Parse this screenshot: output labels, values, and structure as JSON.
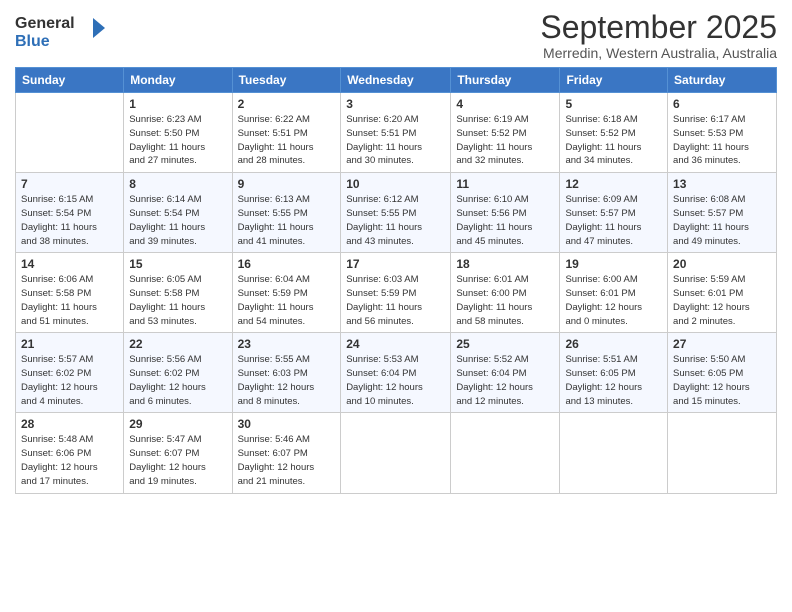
{
  "logo": {
    "line1": "General",
    "line2": "Blue"
  },
  "title": "September 2025",
  "subtitle": "Merredin, Western Australia, Australia",
  "headers": [
    "Sunday",
    "Monday",
    "Tuesday",
    "Wednesday",
    "Thursday",
    "Friday",
    "Saturday"
  ],
  "weeks": [
    [
      {
        "day": "",
        "info": ""
      },
      {
        "day": "1",
        "info": "Sunrise: 6:23 AM\nSunset: 5:50 PM\nDaylight: 11 hours\nand 27 minutes."
      },
      {
        "day": "2",
        "info": "Sunrise: 6:22 AM\nSunset: 5:51 PM\nDaylight: 11 hours\nand 28 minutes."
      },
      {
        "day": "3",
        "info": "Sunrise: 6:20 AM\nSunset: 5:51 PM\nDaylight: 11 hours\nand 30 minutes."
      },
      {
        "day": "4",
        "info": "Sunrise: 6:19 AM\nSunset: 5:52 PM\nDaylight: 11 hours\nand 32 minutes."
      },
      {
        "day": "5",
        "info": "Sunrise: 6:18 AM\nSunset: 5:52 PM\nDaylight: 11 hours\nand 34 minutes."
      },
      {
        "day": "6",
        "info": "Sunrise: 6:17 AM\nSunset: 5:53 PM\nDaylight: 11 hours\nand 36 minutes."
      }
    ],
    [
      {
        "day": "7",
        "info": "Sunrise: 6:15 AM\nSunset: 5:54 PM\nDaylight: 11 hours\nand 38 minutes."
      },
      {
        "day": "8",
        "info": "Sunrise: 6:14 AM\nSunset: 5:54 PM\nDaylight: 11 hours\nand 39 minutes."
      },
      {
        "day": "9",
        "info": "Sunrise: 6:13 AM\nSunset: 5:55 PM\nDaylight: 11 hours\nand 41 minutes."
      },
      {
        "day": "10",
        "info": "Sunrise: 6:12 AM\nSunset: 5:55 PM\nDaylight: 11 hours\nand 43 minutes."
      },
      {
        "day": "11",
        "info": "Sunrise: 6:10 AM\nSunset: 5:56 PM\nDaylight: 11 hours\nand 45 minutes."
      },
      {
        "day": "12",
        "info": "Sunrise: 6:09 AM\nSunset: 5:57 PM\nDaylight: 11 hours\nand 47 minutes."
      },
      {
        "day": "13",
        "info": "Sunrise: 6:08 AM\nSunset: 5:57 PM\nDaylight: 11 hours\nand 49 minutes."
      }
    ],
    [
      {
        "day": "14",
        "info": "Sunrise: 6:06 AM\nSunset: 5:58 PM\nDaylight: 11 hours\nand 51 minutes."
      },
      {
        "day": "15",
        "info": "Sunrise: 6:05 AM\nSunset: 5:58 PM\nDaylight: 11 hours\nand 53 minutes."
      },
      {
        "day": "16",
        "info": "Sunrise: 6:04 AM\nSunset: 5:59 PM\nDaylight: 11 hours\nand 54 minutes."
      },
      {
        "day": "17",
        "info": "Sunrise: 6:03 AM\nSunset: 5:59 PM\nDaylight: 11 hours\nand 56 minutes."
      },
      {
        "day": "18",
        "info": "Sunrise: 6:01 AM\nSunset: 6:00 PM\nDaylight: 11 hours\nand 58 minutes."
      },
      {
        "day": "19",
        "info": "Sunrise: 6:00 AM\nSunset: 6:01 PM\nDaylight: 12 hours\nand 0 minutes."
      },
      {
        "day": "20",
        "info": "Sunrise: 5:59 AM\nSunset: 6:01 PM\nDaylight: 12 hours\nand 2 minutes."
      }
    ],
    [
      {
        "day": "21",
        "info": "Sunrise: 5:57 AM\nSunset: 6:02 PM\nDaylight: 12 hours\nand 4 minutes."
      },
      {
        "day": "22",
        "info": "Sunrise: 5:56 AM\nSunset: 6:02 PM\nDaylight: 12 hours\nand 6 minutes."
      },
      {
        "day": "23",
        "info": "Sunrise: 5:55 AM\nSunset: 6:03 PM\nDaylight: 12 hours\nand 8 minutes."
      },
      {
        "day": "24",
        "info": "Sunrise: 5:53 AM\nSunset: 6:04 PM\nDaylight: 12 hours\nand 10 minutes."
      },
      {
        "day": "25",
        "info": "Sunrise: 5:52 AM\nSunset: 6:04 PM\nDaylight: 12 hours\nand 12 minutes."
      },
      {
        "day": "26",
        "info": "Sunrise: 5:51 AM\nSunset: 6:05 PM\nDaylight: 12 hours\nand 13 minutes."
      },
      {
        "day": "27",
        "info": "Sunrise: 5:50 AM\nSunset: 6:05 PM\nDaylight: 12 hours\nand 15 minutes."
      }
    ],
    [
      {
        "day": "28",
        "info": "Sunrise: 5:48 AM\nSunset: 6:06 PM\nDaylight: 12 hours\nand 17 minutes."
      },
      {
        "day": "29",
        "info": "Sunrise: 5:47 AM\nSunset: 6:07 PM\nDaylight: 12 hours\nand 19 minutes."
      },
      {
        "day": "30",
        "info": "Sunrise: 5:46 AM\nSunset: 6:07 PM\nDaylight: 12 hours\nand 21 minutes."
      },
      {
        "day": "",
        "info": ""
      },
      {
        "day": "",
        "info": ""
      },
      {
        "day": "",
        "info": ""
      },
      {
        "day": "",
        "info": ""
      }
    ]
  ]
}
